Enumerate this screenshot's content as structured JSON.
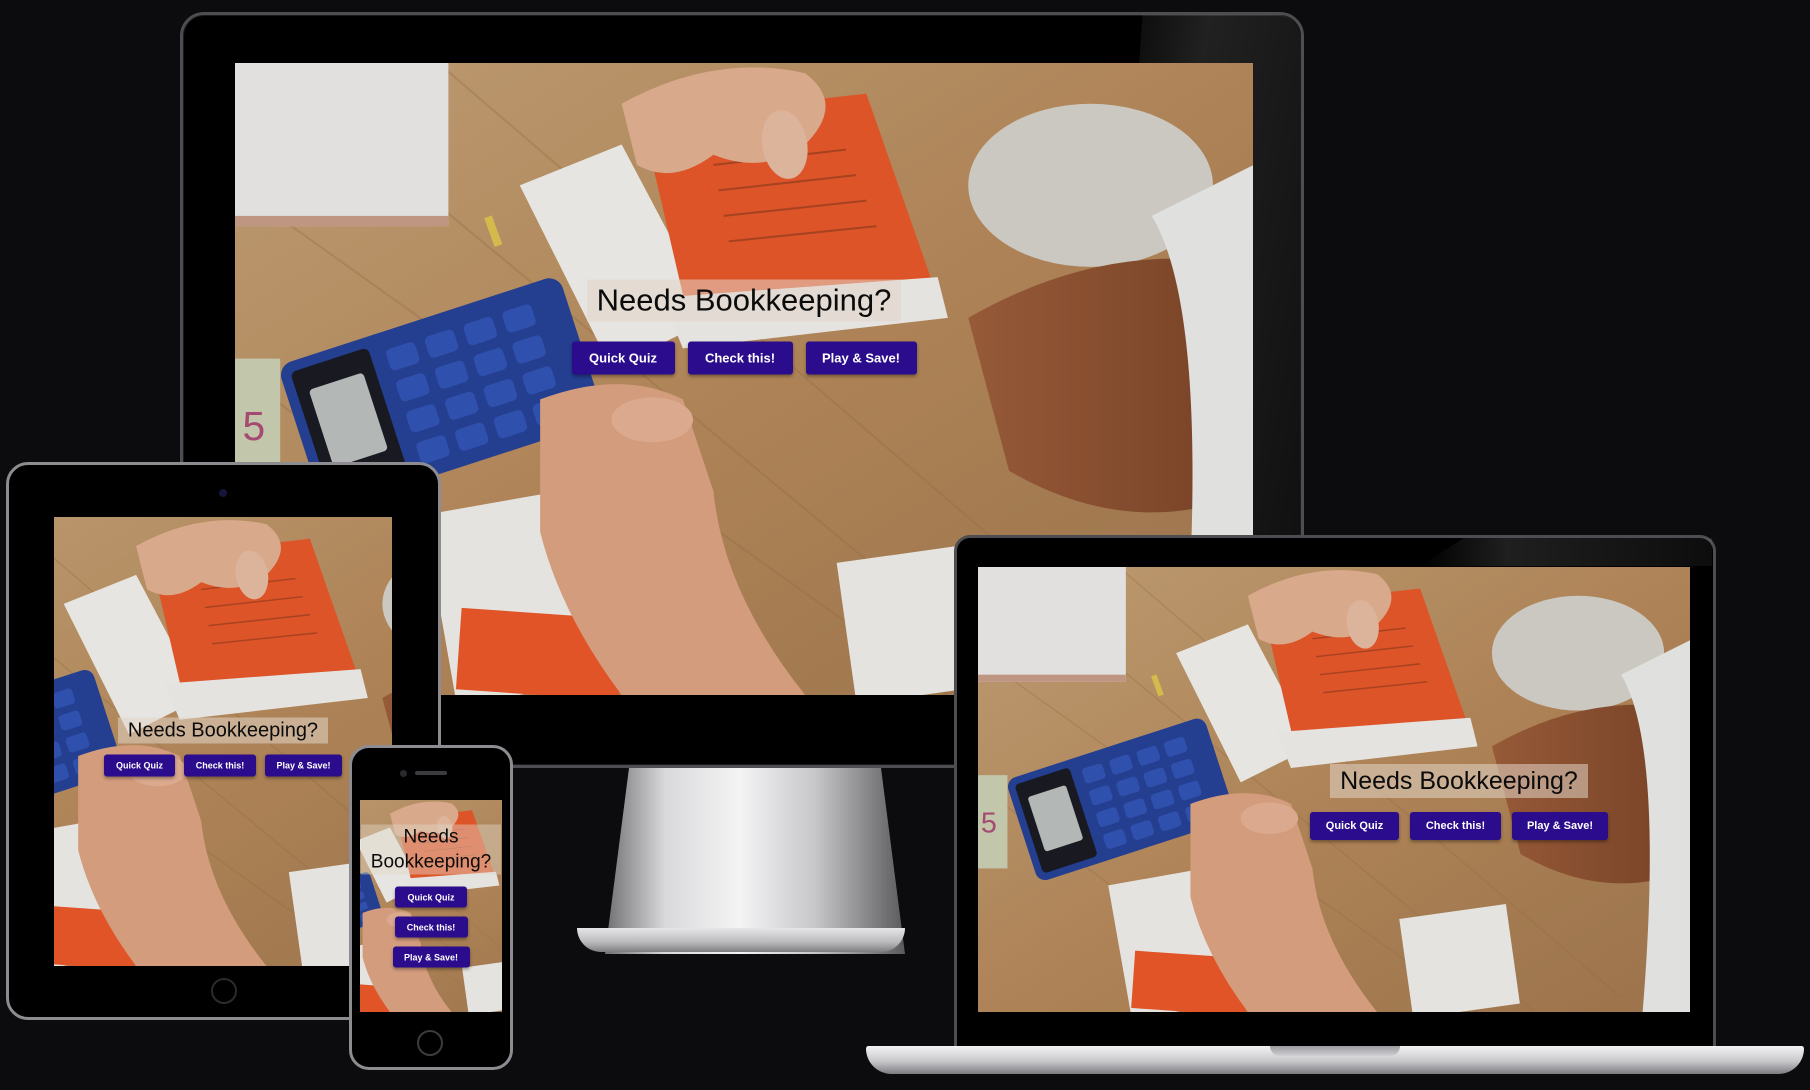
{
  "hero": {
    "title": "Needs Bookkeeping?",
    "title_phone_line1": "Needs",
    "title_phone_line2": "Bookkeeping?"
  },
  "buttons": {
    "quiz": "Quick Quiz",
    "check": "Check this!",
    "play": "Play & Save!"
  },
  "colors": {
    "button": "#2a0c8c",
    "page_background": "#0c0b0d",
    "device_frame": "#000000"
  },
  "devices": [
    "desktop-monitor",
    "tablet",
    "laptop",
    "phone"
  ]
}
